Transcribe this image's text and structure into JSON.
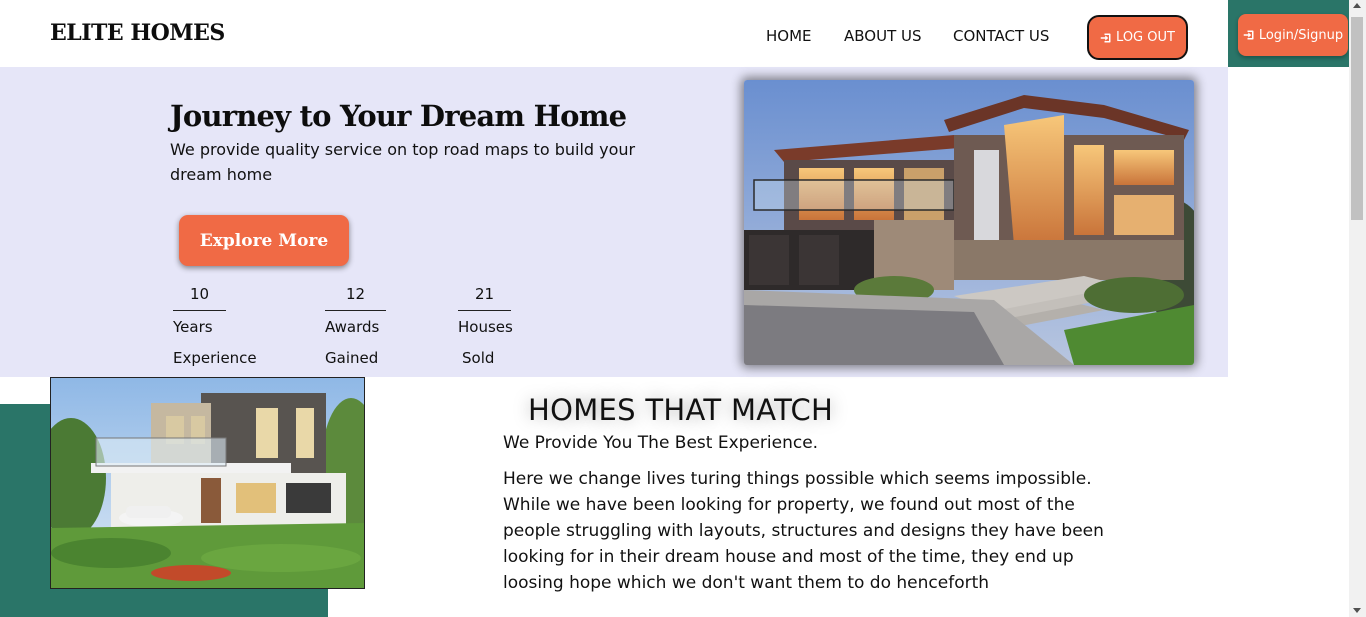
{
  "header": {
    "logo": "ELITE HOMES",
    "nav": [
      "HOME",
      "ABOUT US",
      "CONTACT US"
    ],
    "logout_label": "LOG OUT",
    "login_label": "Login/Signup"
  },
  "hero": {
    "title": "Journey to Your Dream Home",
    "subtitle": "We provide quality service on top road maps to build your dream home",
    "cta_label": "Explore More",
    "stats": [
      {
        "value": "10",
        "label_line1": "Years",
        "label_line2": "Experience"
      },
      {
        "value": "12",
        "label_line1": "Awards",
        "label_line2": "Gained"
      },
      {
        "value": "21",
        "label_line1": "Houses",
        "label_line2": "Sold"
      }
    ],
    "image_icon": "modern-house-dusk-photo"
  },
  "section": {
    "title": "HOMES THAT MATCH",
    "subtitle": "We Provide You The Best Experience.",
    "body": "Here we change lives turing things possible which seems impossible. While we have been looking for property, we found out most of the people struggling with layouts, structures and designs they have been looking for in their dream house and most of the time, they end up loosing hope which we don't want them to do henceforth",
    "image_icon": "modern-house-daylight-photo"
  },
  "colors": {
    "accent": "#f06a45",
    "teal": "#2a7568",
    "hero_bg": "#e6e6f8"
  }
}
